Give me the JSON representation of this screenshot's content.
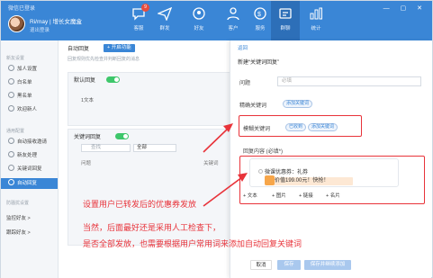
{
  "window": {
    "title": "微信已登录",
    "controls": "— ▢ ✕"
  },
  "profile": {
    "name": "Ri/may | 增长女魔盒",
    "status": "退出登录"
  },
  "nav": [
    {
      "label": "客服",
      "icon": "chat-bubble-icon",
      "badge": "9"
    },
    {
      "label": "群发",
      "icon": "send-icon",
      "badge": ""
    },
    {
      "label": "好友",
      "icon": "friends-icon",
      "badge": ""
    },
    {
      "label": "客户",
      "icon": "customer-icon",
      "badge": ""
    },
    {
      "label": "服务",
      "icon": "service-icon",
      "badge": ""
    },
    {
      "label": "群聊",
      "icon": "group-icon",
      "badge": ""
    },
    {
      "label": "统计",
      "icon": "stats-icon",
      "badge": ""
    }
  ],
  "sidebar": {
    "sections": [
      "新友设置",
      "通用配置",
      "防骚扰设置"
    ],
    "items": [
      {
        "label": "加人设置"
      },
      {
        "label": "白名单"
      },
      {
        "label": "黑名单"
      },
      {
        "label": "欢迎新人"
      },
      {
        "label": "自动接收邀请"
      },
      {
        "label": "新友处理"
      },
      {
        "label": "关键词回复"
      },
      {
        "label": "自动回复"
      }
    ],
    "plain": [
      "监控好友  >",
      "跟踪好友  >"
    ]
  },
  "main": {
    "title": "自动回复",
    "add_button": "+ 开启功能",
    "desc": "回复规则优先检查并判断回复的消息",
    "default_reply": {
      "label": "默认回复",
      "enabled": true,
      "text": "1文本"
    },
    "keyword_reply": {
      "label": "关键词回复",
      "enabled": true,
      "search_placeholder": "查找",
      "filter": "全部",
      "col_question": "问题",
      "col_keyword": "关键词"
    }
  },
  "dialog": {
    "back": "返回",
    "title": "新建“关键词回复”",
    "question_label": "问题",
    "question_value": "必填",
    "exact_label": "精确关键词",
    "exact_add": "添加关键词",
    "fuzzy_label": "模糊关键词",
    "fuzzy_tags": [
      "已收到",
      "添加关键词"
    ],
    "reply_label": "回复内容 (必填*)",
    "coupon": {
      "title": "微课优惠券：礼券",
      "text": "价值199.00元！快抢！"
    },
    "reply_options": [
      "+ 文本",
      "+ 图片",
      "+ 链接",
      "+ 名片"
    ],
    "footer": {
      "cancel": "取消",
      "save": "保存",
      "save_continue": "保存并继续添加"
    }
  },
  "annotations": {
    "note1": "设置用户已转发后的优惠券发放",
    "note2": "当然，后面最好还是采用人工检查下，",
    "note3": "是否全部发放，也需要根据用户常用词来添加自动回复关键词"
  },
  "colors": {
    "accent": "#3a86d6",
    "highlight": "#e8333a",
    "toggle_on": "#3ec76b"
  }
}
